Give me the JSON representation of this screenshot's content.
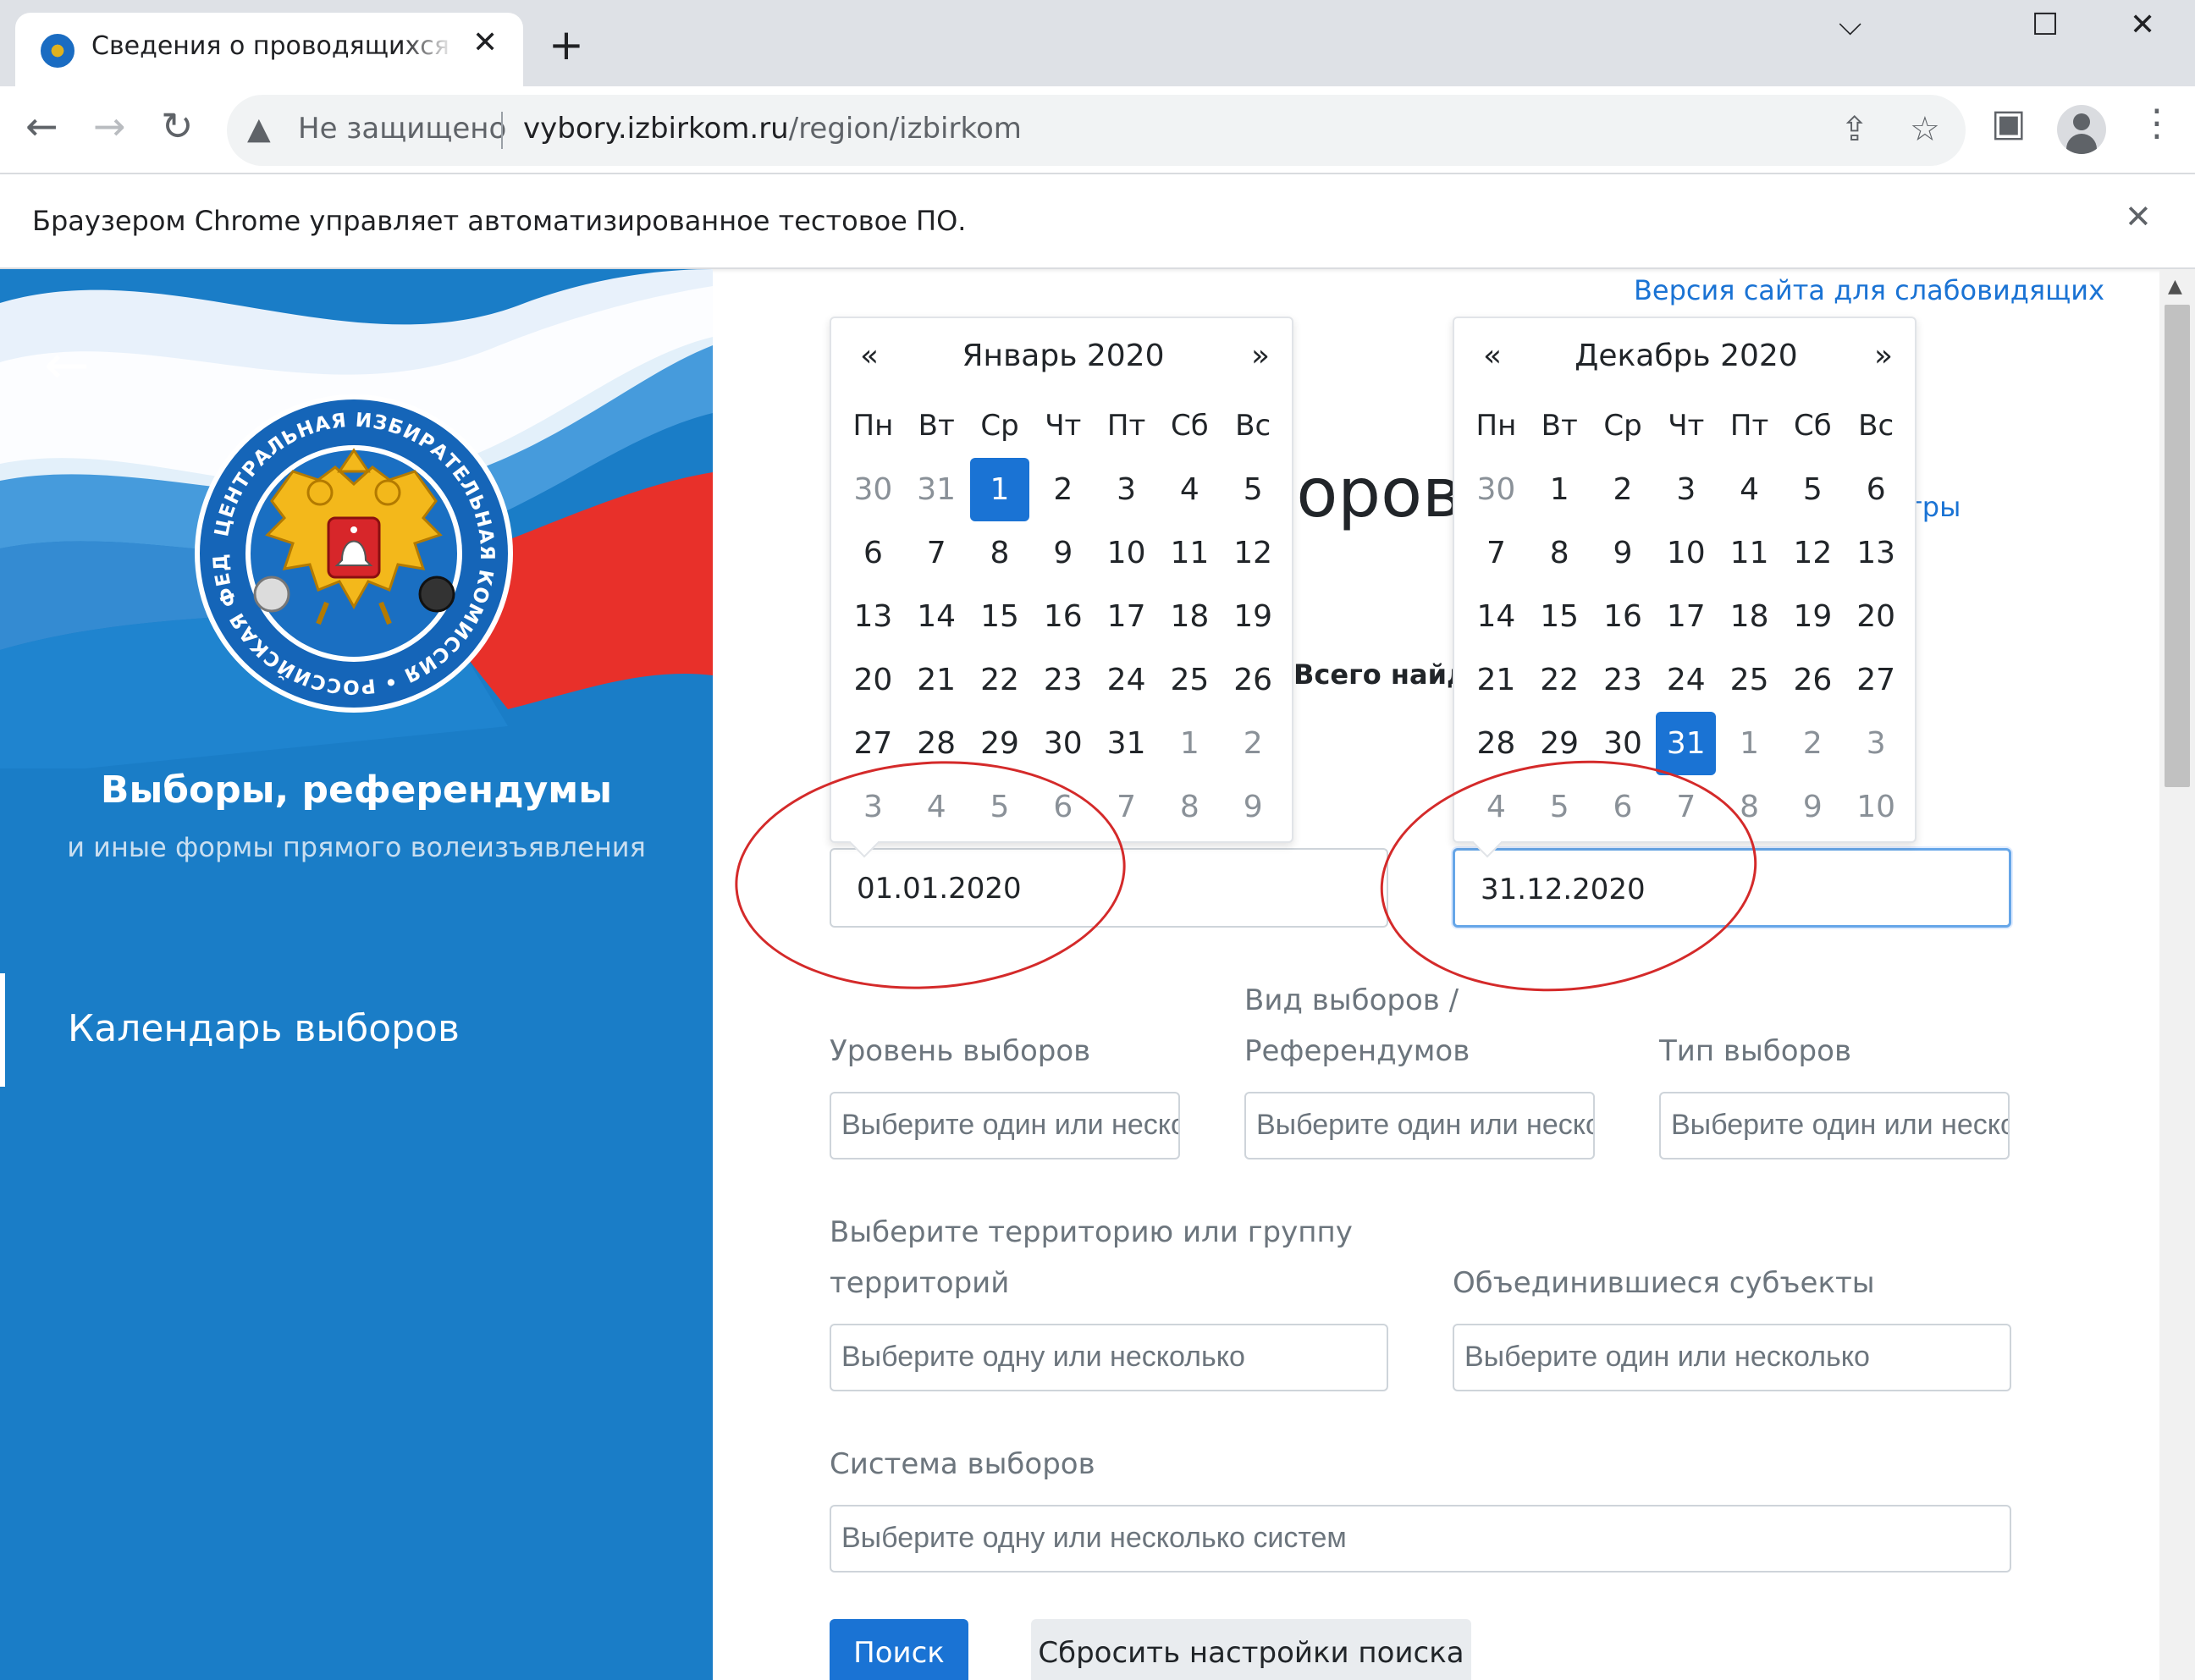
{
  "browser": {
    "tab_title": "Сведения о проводящихся выборах",
    "tab_close": "✕",
    "new_tab": "+",
    "window_minimize": "⌵",
    "window_maximize": "☐",
    "window_close": "✕",
    "not_secure": "Не защищено",
    "url_host": "vybory.izbirkom.ru",
    "url_path": "/region/izbirkom",
    "infobar_text": "Браузером Chrome управляет автоматизированное тестовое ПО.",
    "infobar_close": "✕"
  },
  "sidebar": {
    "back": "←",
    "title": "Выборы, референдумы",
    "subtitle": "и иные формы прямого волеизъявления",
    "nav_item": "Календарь выборов",
    "emblem_ring_text": "ЦЕНТРАЛЬНАЯ ИЗБИРАТЕЛЬНАЯ КОМИССИЯ • РОССИЙСКАЯ ФЕДЕРАЦИЯ •"
  },
  "main": {
    "accessible_link": "Версия сайта для слабовидящих",
    "heading_visible": "боров",
    "filters_link_visible": "ильтры",
    "total_found_visible": "Всего найде"
  },
  "calendar_start": {
    "prev": "«",
    "next": "»",
    "title": "Январь 2020",
    "weekdays": [
      "Пн",
      "Вт",
      "Ср",
      "Чт",
      "Пт",
      "Сб",
      "Вс"
    ],
    "weeks": [
      [
        "30",
        "31",
        "1",
        "2",
        "3",
        "4",
        "5"
      ],
      [
        "6",
        "7",
        "8",
        "9",
        "10",
        "11",
        "12"
      ],
      [
        "13",
        "14",
        "15",
        "16",
        "17",
        "18",
        "19"
      ],
      [
        "20",
        "21",
        "22",
        "23",
        "24",
        "25",
        "26"
      ],
      [
        "27",
        "28",
        "29",
        "30",
        "31",
        "1",
        "2"
      ],
      [
        "3",
        "4",
        "5",
        "6",
        "7",
        "8",
        "9"
      ]
    ],
    "selected": "1"
  },
  "calendar_end": {
    "prev": "«",
    "next": "»",
    "title": "Декабрь 2020",
    "weekdays": [
      "Пн",
      "Вт",
      "Ср",
      "Чт",
      "Пт",
      "Сб",
      "Вс"
    ],
    "weeks": [
      [
        "30",
        "1",
        "2",
        "3",
        "4",
        "5",
        "6"
      ],
      [
        "7",
        "8",
        "9",
        "10",
        "11",
        "12",
        "13"
      ],
      [
        "14",
        "15",
        "16",
        "17",
        "18",
        "19",
        "20"
      ],
      [
        "21",
        "22",
        "23",
        "24",
        "25",
        "26",
        "27"
      ],
      [
        "28",
        "29",
        "30",
        "31",
        "1",
        "2",
        "3"
      ],
      [
        "4",
        "5",
        "6",
        "7",
        "8",
        "9",
        "10"
      ]
    ],
    "selected": "31"
  },
  "form": {
    "date_from": "01.01.2020",
    "date_to": "31.12.2020",
    "level_label": "Уровень выборов",
    "level_placeholder": "Выберите один или несколько",
    "kind_label_1": "Вид выборов /",
    "kind_label_2": "Референдумов",
    "kind_placeholder": "Выберите один или несколько",
    "type_label": "Тип выборов",
    "type_placeholder": "Выберите один или несколько",
    "territory_label_1": "Выберите территорию или группу",
    "territory_label_2": "территорий",
    "territory_placeholder": "Выберите одну или несколько",
    "merged_label": "Объединившиеся субъекты",
    "merged_placeholder": "Выберите один или несколько",
    "system_label": "Система выборов",
    "system_placeholder": "Выберите одну или несколько систем",
    "search_button": "Поиск",
    "reset_button": "Сбросить настройки поиска"
  },
  "colors": {
    "sidebar_blue": "#1a7dc7",
    "link_blue": "#1a73d4",
    "annotation_red": "#d42a2a"
  }
}
